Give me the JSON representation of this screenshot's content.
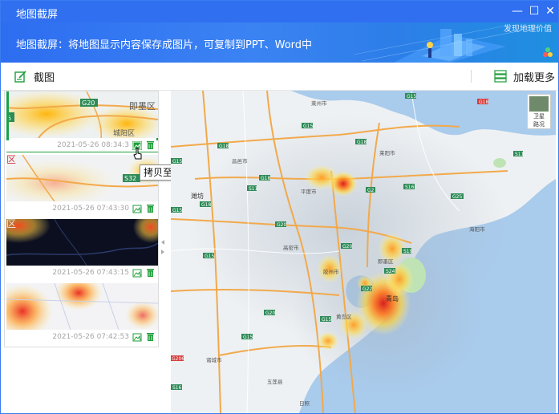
{
  "window": {
    "title": "地图截屏",
    "buttons": [
      "—",
      "☐",
      "✕"
    ]
  },
  "banner": {
    "description": "地图截屏：将地图显示内容保存成图片，可复制到PPT、Word中",
    "brand": "发现地理价值"
  },
  "toolbar": {
    "capture_label": "截图",
    "load_more_label": "加载更多"
  },
  "thumbnails": [
    {
      "timestamp": "2021-05-26 08:34:3",
      "labels": [
        "G20",
        "即墨区",
        "城阳区",
        "5"
      ],
      "selected": true
    },
    {
      "timestamp": "2021-05-26 07:43:30",
      "labels": [
        "区",
        "S32"
      ],
      "selected": false
    },
    {
      "timestamp": "2021-05-26 07:43:15",
      "labels": [
        "区"
      ],
      "selected": false
    },
    {
      "timestamp": "2021-05-26 07:42:53",
      "labels": [],
      "selected": false
    }
  ],
  "tooltip": "拷贝至剪贴板",
  "map": {
    "layer_switch": {
      "top": "卫星",
      "bottom": "路况"
    },
    "road_shields": [
      "G15",
      "G18",
      "G15",
      "S11",
      "G18",
      "G15",
      "G18",
      "S16",
      "G25",
      "G15",
      "G18",
      "G2",
      "G20",
      "G20",
      "G22",
      "G15",
      "G15",
      "S24",
      "G20",
      "S19",
      "S11",
      "G18",
      "S16",
      "G15",
      "G206"
    ],
    "places": [
      "莱州市",
      "莱阳市",
      "昌邑市",
      "平度市",
      "潍坊",
      "即墨区",
      "海阳市",
      "青岛",
      "黄岛区",
      "胶州市",
      "高密市",
      "诸城市",
      "五莲县",
      "日照"
    ]
  },
  "colors": {
    "titlebar": "#2f6ff0",
    "accent_green": "#16a34a",
    "sea": "#a9cbec",
    "land": "#eef2f4",
    "road_orange": "#f2a94b"
  }
}
